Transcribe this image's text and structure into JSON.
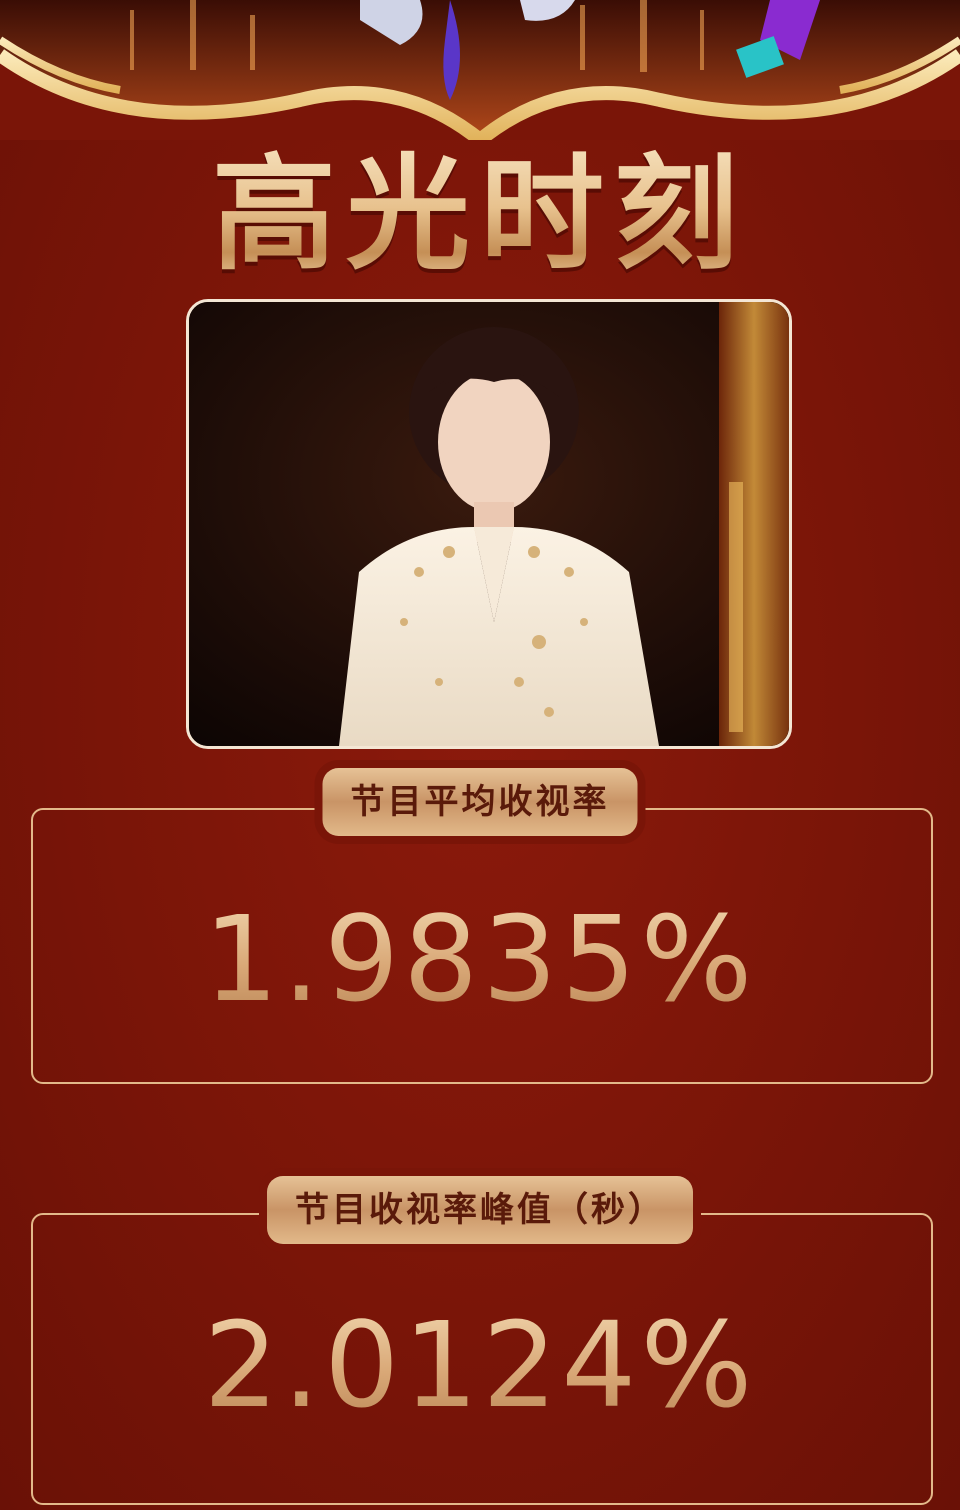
{
  "title": "高光时刻",
  "photo": {
    "icon": "performer-photo"
  },
  "stats": [
    {
      "label": "节目平均收视率",
      "value": "1.9835%"
    },
    {
      "label": "节目收视率峰值（秒）",
      "value": "2.0124%"
    }
  ],
  "colors": {
    "background": "#7a1508",
    "gold": "#e3b98a",
    "label_text": "#5a1a0a"
  }
}
